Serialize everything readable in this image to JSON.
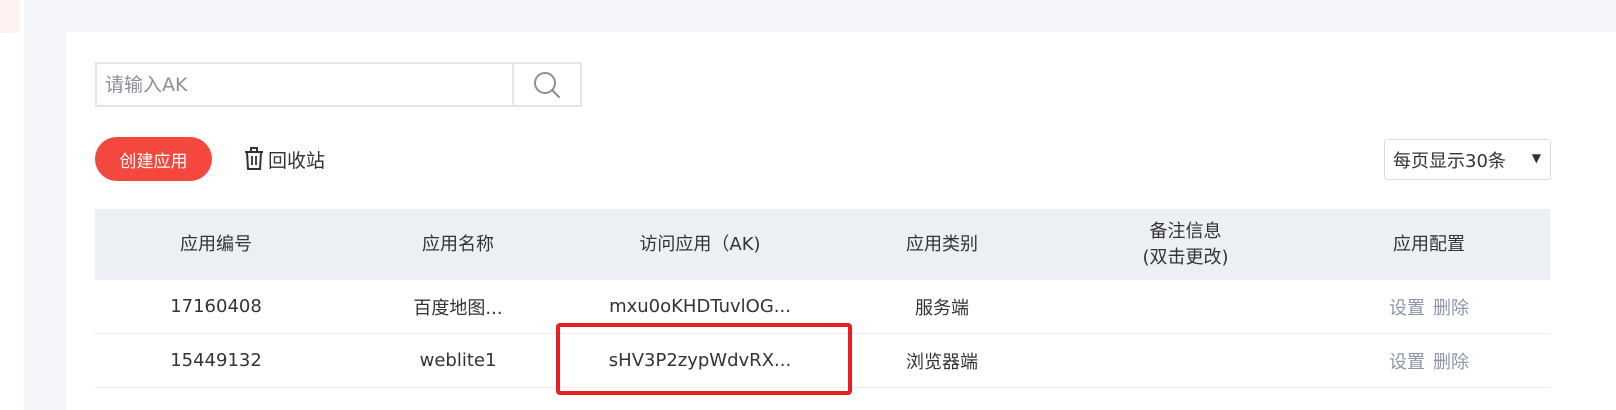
{
  "search": {
    "placeholder": "请输入AK",
    "value": "",
    "icon": "search-icon"
  },
  "toolbar": {
    "create_label": "创建应用",
    "recycle_label": "回收站",
    "recycle_icon": "trash-icon",
    "page_size_label": "每页显示30条"
  },
  "table": {
    "headers": [
      "应用编号",
      "应用名称",
      "访问应用（AK)",
      "应用类别",
      "备注信息\n(双击更改)",
      "应用配置"
    ],
    "rows": [
      {
        "id": "17160408",
        "name": "百度地图...",
        "ak": "mxu0oKHDTuvlOG...",
        "type": "服务端",
        "note": "",
        "actions": [
          "设置",
          "删除"
        ]
      },
      {
        "id": "15449132",
        "name": "weblite1",
        "ak": "sHV3P2zypWdvRX...",
        "type": "浏览器端",
        "note": "",
        "actions": [
          "设置",
          "删除"
        ]
      }
    ]
  },
  "colors": {
    "accent": "#f4473d",
    "highlight": "#e5201f",
    "header_bg": "#eceff4",
    "action_link": "#8a96ad"
  }
}
